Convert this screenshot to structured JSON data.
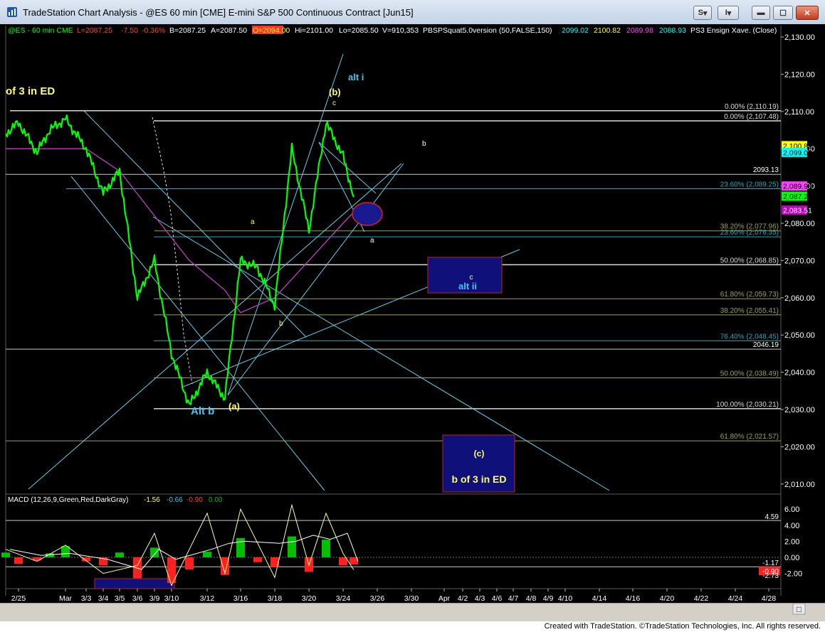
{
  "window": {
    "title": "TradeStation Chart Analysis - @ES 60 min [CME] E-mini S&P 500 Continuous Contract [Jun15]",
    "s_button": "S",
    "i_button": "I"
  },
  "colors": {
    "background": "#000000",
    "price_bars": "#00ff00",
    "moving_average": "#c040c0",
    "trendline": "#5fd0e8",
    "fib_white": "#d8d8d8",
    "fib_olive": "#a0a050",
    "fib_cyan": "#2aa6b8",
    "label_yellow": "#ffff66",
    "label_cyan": "#40c8f0",
    "box_fill": "#10107a",
    "box_border": "#c02020"
  },
  "status_line": {
    "symbol": "@ES - 60 min  CME",
    "last": "L=2087.25",
    "net": "-7.50",
    "pct": "-0.36%",
    "bid": "B=2087.25",
    "ask": "A=2087.50",
    "open": "O=2094.00",
    "hi": "Hi=2101.00",
    "lo": "Lo=2085.50",
    "volume": "V=910,353",
    "indicator": "PBSPSquat5.0version (50,FALSE,150)",
    "ind_values": [
      "2099.02",
      "2100.82",
      "2089.98",
      "2088.93"
    ],
    "ps3": "PS3 Ensign Xave. (Close)"
  },
  "chart_data": {
    "type": "line",
    "title": "@ES 60 min [CME] E-mini S&P 500 Continuous Contract [Jun15]",
    "x_tick_labels": [
      "2/25",
      "Mar",
      "3/3",
      "3/4",
      "3/5",
      "3/6",
      "3/9",
      "3/10",
      "3/12",
      "3/16",
      "3/18",
      "3/20",
      "3/24",
      "3/26",
      "3/30",
      "Apr",
      "4/2",
      "4/3",
      "4/6",
      "4/7",
      "4/8",
      "4/9",
      "4/10",
      "4/14",
      "4/16",
      "4/20",
      "4/22",
      "4/24",
      "4/28"
    ],
    "price_axis_ticks": [
      "2,130.00",
      "2,120.00",
      "2,110.00",
      "2,100.00",
      "2,090.00",
      "2,080.00",
      "2,070.00",
      "2,060.00",
      "2,050.00",
      "2,040.00",
      "2,030.00",
      "2,020.00",
      "2,010.00"
    ],
    "ylim": [
      2004,
      2137
    ],
    "price_path": [
      {
        "date": "2/24",
        "price": 2104
      },
      {
        "date": "2/25",
        "price": 2107
      },
      {
        "date": "2/26",
        "price": 2099
      },
      {
        "date": "2/27",
        "price": 2105
      },
      {
        "date": "3/2",
        "price": 2108
      },
      {
        "date": "3/3",
        "price": 2100
      },
      {
        "date": "3/4",
        "price": 2088
      },
      {
        "date": "3/5",
        "price": 2094
      },
      {
        "date": "3/6",
        "price": 2060
      },
      {
        "date": "3/9",
        "price": 2070
      },
      {
        "date": "3/10",
        "price": 2045
      },
      {
        "date": "3/11",
        "price": 2031
      },
      {
        "date": "3/12",
        "price": 2040
      },
      {
        "date": "3/13",
        "price": 2033
      },
      {
        "date": "3/16",
        "price": 2070
      },
      {
        "date": "3/17",
        "price": 2068
      },
      {
        "date": "3/18",
        "price": 2058
      },
      {
        "date": "3/19",
        "price": 2100
      },
      {
        "date": "3/20",
        "price": 2078
      },
      {
        "date": "3/23",
        "price": 2107
      },
      {
        "date": "3/24",
        "price": 2098
      },
      {
        "date": "3/25",
        "price": 2087
      }
    ],
    "moving_average": [
      {
        "date": "2/24",
        "price": 2100
      },
      {
        "date": "3/3",
        "price": 2100
      },
      {
        "date": "3/5",
        "price": 2094
      },
      {
        "date": "3/9",
        "price": 2082
      },
      {
        "date": "3/11",
        "price": 2070
      },
      {
        "date": "3/13",
        "price": 2062
      },
      {
        "date": "3/16",
        "price": 2056
      },
      {
        "date": "3/18",
        "price": 2060
      },
      {
        "date": "3/20",
        "price": 2070
      },
      {
        "date": "3/24",
        "price": 2080
      },
      {
        "date": "3/25",
        "price": 2083
      }
    ],
    "fib_levels": [
      {
        "label": "0.00% (2,110.19)",
        "value": 2110.19,
        "style": "white"
      },
      {
        "label": "0.00% (2,107.48)",
        "value": 2107.48,
        "style": "white"
      },
      {
        "label": "23.60% (2,089.25)",
        "value": 2089.25,
        "style": "cyan"
      },
      {
        "label": "38.20% (2,077.96)",
        "value": 2077.96,
        "style": "olive"
      },
      {
        "label": "23.60% (2,076.35)",
        "value": 2076.35,
        "style": "cyan"
      },
      {
        "label": "50.00% (2,068.85)",
        "value": 2068.85,
        "style": "white"
      },
      {
        "label": "61.80% (2,059.73)",
        "value": 2059.73,
        "style": "olive"
      },
      {
        "label": "38.20% (2,055.41)",
        "value": 2055.41,
        "style": "olive"
      },
      {
        "label": "76.40% (2,048.45)",
        "value": 2048.45,
        "style": "cyan"
      },
      {
        "label": "50.00% (2,038.49)",
        "value": 2038.49,
        "style": "olive"
      },
      {
        "label": "100.00% (2,030.21)",
        "value": 2030.21,
        "style": "white"
      },
      {
        "label": "61.80% (2,021.57)",
        "value": 2021.57,
        "style": "olive"
      }
    ],
    "horizontal_lines": [
      {
        "label": "2093.13",
        "value": 2093.13
      },
      {
        "label": "2046.19",
        "value": 2046.19
      }
    ],
    "price_markers": [
      {
        "label": "2,100.82",
        "value": 2100.82,
        "bg": "#ffff00",
        "fg": "#000000"
      },
      {
        "label": "2,099.02",
        "value": 2099.02,
        "bg": "#00ffff",
        "fg": "#000000"
      },
      {
        "label": "2,089.98",
        "value": 2089.98,
        "bg": "#ff40ff",
        "fg": "#000000"
      },
      {
        "label": "2,087.25",
        "value": 2087.25,
        "bg": "#00ff00",
        "fg": "#000000"
      },
      {
        "label": "2,083.51",
        "value": 2083.51,
        "bg": "#c000c0",
        "fg": "#ffffff"
      }
    ],
    "wave_labels": [
      {
        "text": "of 3 in ED",
        "color": "yellow",
        "size": "large"
      },
      {
        "text": "alt i",
        "color": "cyan",
        "size": "medium"
      },
      {
        "text": "(b)",
        "color": "yellow",
        "size": "medium"
      },
      {
        "text": "c",
        "color": "yellow",
        "size": "small"
      },
      {
        "text": "b",
        "color": "white",
        "size": "small"
      },
      {
        "text": "a",
        "color": "yellow",
        "size": "small"
      },
      {
        "text": "a",
        "color": "white",
        "size": "small"
      },
      {
        "text": "b",
        "color": "yellow",
        "size": "small"
      },
      {
        "text": "Alt b",
        "color": "cyan",
        "size": "large"
      },
      {
        "text": "(a)",
        "color": "yellow",
        "size": "medium"
      }
    ],
    "boxes": [
      {
        "lines": [
          "c",
          "alt ii"
        ],
        "price_range": [
          2059,
          2069
        ]
      },
      {
        "lines": [
          "(c)",
          "b of 3 in ED"
        ],
        "price_range": [
          2004,
          2021
        ]
      }
    ],
    "macd": {
      "label": "MACD (12,26,9,Green,Red,DarkGray)",
      "values": [
        "-1.56",
        "-0.66",
        "-0.90",
        "0.00"
      ],
      "value_colors": [
        "#ffff66",
        "#40c8f0",
        "#ff4040",
        "#00c000"
      ],
      "axis_ticks": [
        "6.00",
        "4.00",
        "2.00",
        "0.00",
        "-2.00"
      ],
      "level_labels": [
        "4.59",
        "-1.17",
        "-0.90",
        "-2.73"
      ],
      "ylim": [
        -3.6,
        6.9
      ],
      "upper_level": 4.59,
      "lower_level": -1.17,
      "histogram": [
        {
          "date": "2/24",
          "value": 0.6
        },
        {
          "date": "2/25",
          "value": -0.8
        },
        {
          "date": "2/26",
          "value": -0.4
        },
        {
          "date": "2/27",
          "value": 0.5
        },
        {
          "date": "3/2",
          "value": 1.4
        },
        {
          "date": "3/3",
          "value": -0.5
        },
        {
          "date": "3/4",
          "value": -1.0
        },
        {
          "date": "3/5",
          "value": 0.6
        },
        {
          "date": "3/6",
          "value": -2.6
        },
        {
          "date": "3/9",
          "value": 1.2
        },
        {
          "date": "3/10",
          "value": -3.2
        },
        {
          "date": "3/11",
          "value": -1.5
        },
        {
          "date": "3/12",
          "value": 0.7
        },
        {
          "date": "3/13",
          "value": -2.2
        },
        {
          "date": "3/16",
          "value": 2.4
        },
        {
          "date": "3/17",
          "value": -0.6
        },
        {
          "date": "3/18",
          "value": -1.2
        },
        {
          "date": "3/19",
          "value": 2.6
        },
        {
          "date": "3/20",
          "value": -1.8
        },
        {
          "date": "3/23",
          "value": 2.2
        },
        {
          "date": "3/24",
          "value": -1.0
        },
        {
          "date": "3/25",
          "value": -0.9
        }
      ],
      "macd_line": [
        {
          "date": "2/24",
          "value": 1.0
        },
        {
          "date": "2/26",
          "value": -0.5
        },
        {
          "date": "3/2",
          "value": 1.5
        },
        {
          "date": "3/4",
          "value": -2.0
        },
        {
          "date": "3/6",
          "value": -1.0
        },
        {
          "date": "3/9",
          "value": 3.0
        },
        {
          "date": "3/10",
          "value": -3.5
        },
        {
          "date": "3/12",
          "value": 5.5
        },
        {
          "date": "3/13",
          "value": -2.0
        },
        {
          "date": "3/16",
          "value": 6.0
        },
        {
          "date": "3/18",
          "value": -2.5
        },
        {
          "date": "3/19",
          "value": 6.5
        },
        {
          "date": "3/20",
          "value": -1.0
        },
        {
          "date": "3/23",
          "value": 5.5
        },
        {
          "date": "3/24",
          "value": 0.5
        },
        {
          "date": "3/25",
          "value": -1.56
        }
      ]
    }
  },
  "footer": {
    "text": "Created with TradeStation. ©TradeStation Technologies, Inc. All rights reserved."
  }
}
